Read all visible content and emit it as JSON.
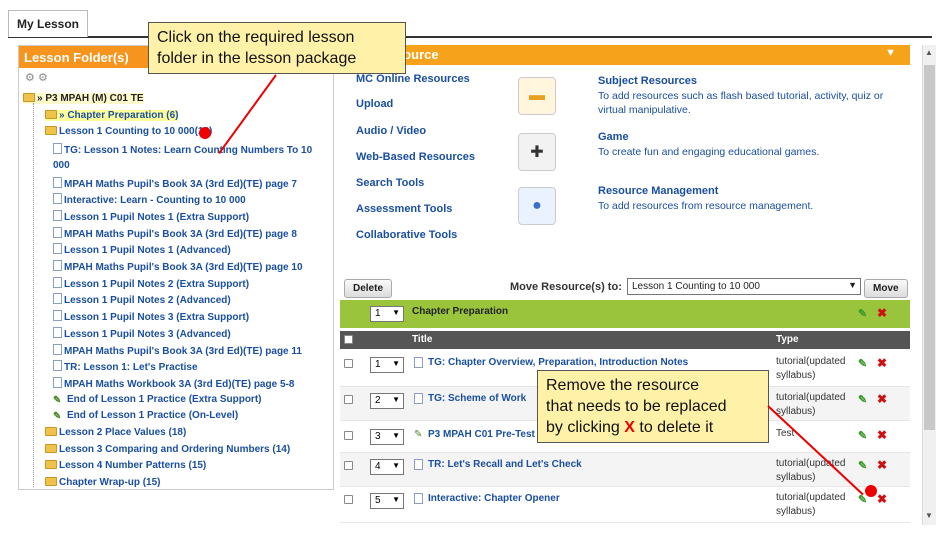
{
  "tab": {
    "label": "My Lesson"
  },
  "left_panel": {
    "title": "Lesson Folder(s)",
    "tree": [
      {
        "label": "» P3 MPAH (M) C01 TE",
        "kind": "root"
      },
      {
        "label": "» Chapter Preparation (6)",
        "kind": "folder-hl"
      },
      {
        "label": "Lesson 1 Counting to 10 000(16)",
        "kind": "folder"
      },
      {
        "label": "TG: Lesson 1 Notes: Learn Counting Numbers To 10",
        "kind": "doc"
      },
      {
        "label": "000",
        "kind": "cont"
      },
      {
        "label": "MPAH Maths Pupil's Book 3A (3rd Ed)(TE) page 7",
        "kind": "doc"
      },
      {
        "label": "Interactive: Learn - Counting to 10 000",
        "kind": "doc"
      },
      {
        "label": "Lesson 1 Pupil Notes 1 (Extra Support)",
        "kind": "doc"
      },
      {
        "label": "MPAH Maths Pupil's Book 3A (3rd Ed)(TE) page 8",
        "kind": "doc"
      },
      {
        "label": "Lesson 1 Pupil Notes 1 (Advanced)",
        "kind": "doc"
      },
      {
        "label": "MPAH Maths Pupil's Book 3A (3rd Ed)(TE) page 10",
        "kind": "doc"
      },
      {
        "label": "Lesson 1 Pupil Notes 2 (Extra Support)",
        "kind": "doc"
      },
      {
        "label": "Lesson 1 Pupil Notes 2 (Advanced)",
        "kind": "doc"
      },
      {
        "label": "Lesson 1 Pupil Notes 3 (Extra Support)",
        "kind": "doc"
      },
      {
        "label": "Lesson 1 Pupil Notes 3 (Advanced)",
        "kind": "doc"
      },
      {
        "label": "MPAH Maths Pupil's Book 3A (3rd Ed)(TE) page 11",
        "kind": "doc"
      },
      {
        "label": "TR: Lesson 1: Let's Practise",
        "kind": "doc"
      },
      {
        "label": "MPAH Maths Workbook 3A (3rd Ed)(TE) page 5-8",
        "kind": "doc"
      },
      {
        "label": "End of Lesson 1 Practice (Extra Support)",
        "kind": "pencil"
      },
      {
        "label": "End of Lesson 1 Practice (On-Level)",
        "kind": "pencil"
      },
      {
        "label": "Lesson 2 Place Values (18)",
        "kind": "folder"
      },
      {
        "label": "Lesson 3 Comparing and Ordering Numbers (14)",
        "kind": "folder"
      },
      {
        "label": "Lesson 4 Number Patterns (15)",
        "kind": "folder"
      },
      {
        "label": "Chapter Wrap-up (15)",
        "kind": "folder"
      }
    ]
  },
  "right_panel": {
    "header_partial": "source",
    "menu": [
      "MC Online Resources",
      "Upload",
      "Audio / Video",
      "Web-Based Resources",
      "Search Tools",
      "Assessment Tools",
      "Collaborative Tools"
    ],
    "resources": [
      {
        "title": "Subject Resources",
        "desc": "To add resources such as flash based tutorial, activity, quiz or virtual manipulative.",
        "icon": "folder-icon"
      },
      {
        "title": "Game",
        "desc": "To create fun and engaging educational games.",
        "icon": "gamepad-icon"
      },
      {
        "title": "Resource Management",
        "desc": "To add resources from resource management.",
        "icon": "share-network-icon"
      }
    ],
    "delete_label": "Delete",
    "move_label": "Move Resource(s) to:",
    "move_target": "Lesson 1 Counting to 10 000",
    "move_button": "Move",
    "chapter": {
      "order": "1",
      "title": "Chapter Preparation"
    },
    "columns": {
      "title": "Title",
      "type": "Type"
    },
    "rows": [
      {
        "order": "1",
        "title": "TG: Chapter Overview, Preparation, Introduction Notes",
        "type": "tutorial(updated syllabus)",
        "icon": "doc"
      },
      {
        "order": "2",
        "title": "TG: Scheme of Work",
        "type": "tutorial(updated syllabus)",
        "icon": "doc"
      },
      {
        "order": "3",
        "title": "P3 MPAH C01 Pre-Test",
        "type": "Test",
        "icon": "pencil"
      },
      {
        "order": "4",
        "title": "TR: Let's Recall and Let's Check",
        "type": "tutorial(updated syllabus)",
        "icon": "doc"
      },
      {
        "order": "5",
        "title": "Interactive: Chapter Opener",
        "type": "tutorial(updated syllabus)",
        "icon": "doc"
      }
    ]
  },
  "callouts": {
    "top_line1": "Click on the required lesson",
    "top_line2": "folder in the lesson package",
    "bottom_line1": "Remove the resource",
    "bottom_line2": "that needs to be replaced",
    "bottom_line3_pre": "by clicking ",
    "bottom_line3_x": "X",
    "bottom_line3_post": " to delete it"
  },
  "colors": {
    "accent_orange": "#f7941d",
    "chapter_green": "#9ac43c",
    "link_blue": "#1a4fa0",
    "callout_yellow": "#fff2a8",
    "annotation_red": "#e00000"
  }
}
